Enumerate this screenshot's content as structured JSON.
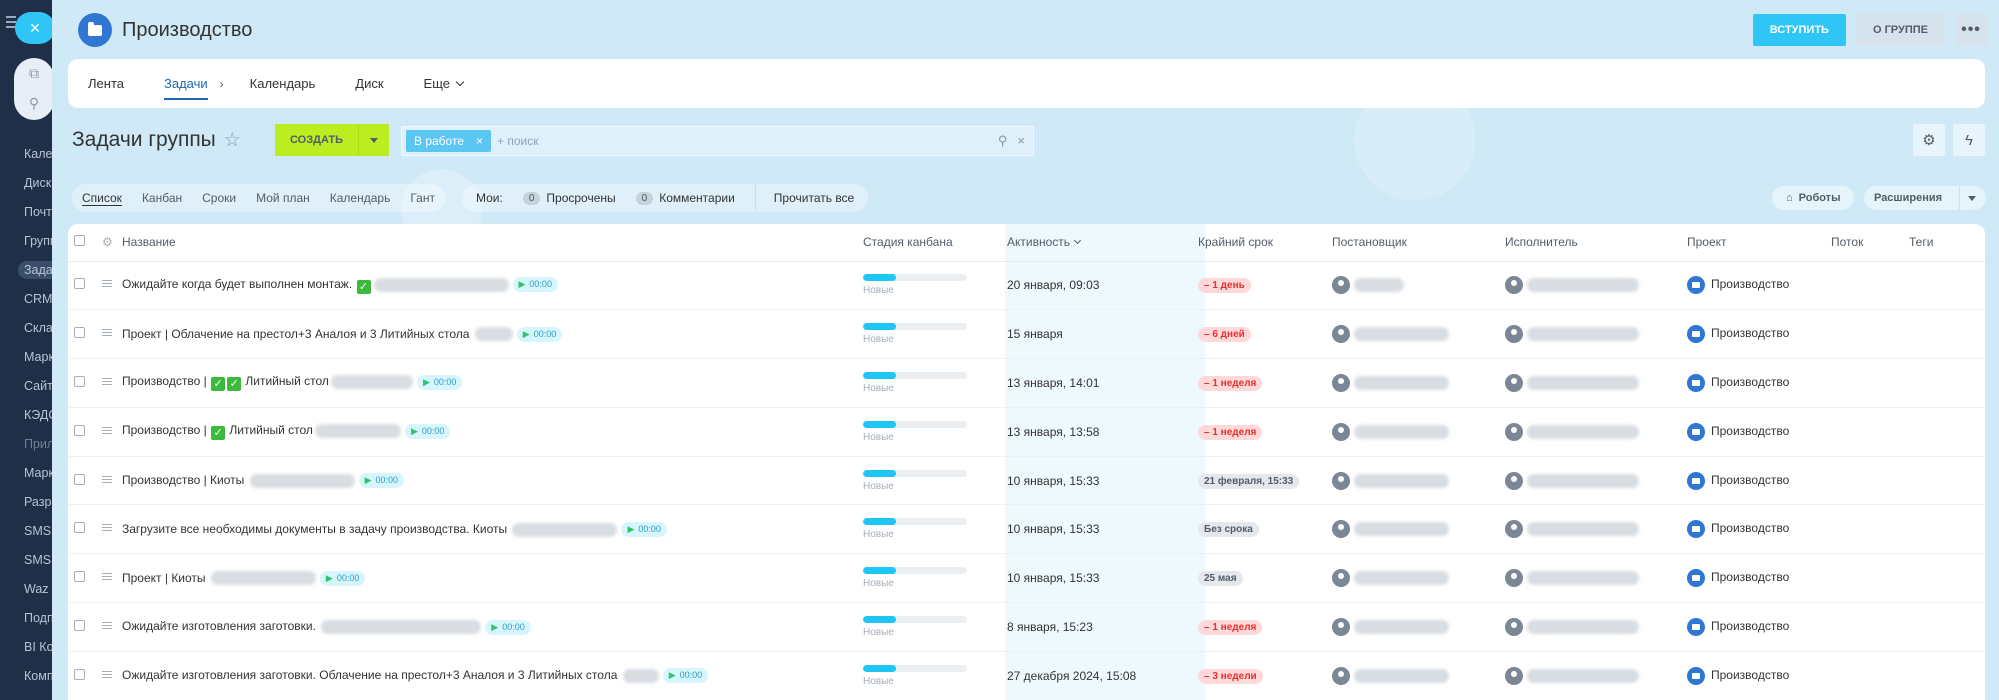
{
  "sidebar": {
    "items": [
      {
        "label": "Кален"
      },
      {
        "label": "Диск"
      },
      {
        "label": "Почт"
      },
      {
        "label": "Групп"
      },
      {
        "label": "Задач"
      },
      {
        "label": "CRM"
      },
      {
        "label": "Склад"
      },
      {
        "label": "Марк"
      },
      {
        "label": "Сайт"
      },
      {
        "label": "КЭДО"
      },
      {
        "label": "Прил"
      },
      {
        "label": "Марк"
      },
      {
        "label": "Разр"
      },
      {
        "label": "SMS"
      },
      {
        "label": "SMS"
      },
      {
        "label": "Waz"
      },
      {
        "label": "Подп"
      },
      {
        "label": "BI Ко"
      },
      {
        "label": "Комп"
      }
    ]
  },
  "header": {
    "group_title": "Производство",
    "join_label": "ВСТУПИТЬ",
    "about_label": "О ГРУППЕ"
  },
  "tabs": {
    "feed": "Лента",
    "tasks": "Задачи",
    "calendar": "Календарь",
    "disk": "Диск",
    "more": "Еще"
  },
  "toolbar": {
    "title": "Задачи группы",
    "create_label": "СОЗДАТЬ",
    "filter_chip": "В работе",
    "search_placeholder": "+ поиск"
  },
  "views": {
    "list": "Список",
    "kanban": "Канбан",
    "deadlines": "Сроки",
    "my_plan": "Мой план",
    "calendar": "Календарь",
    "gantt": "Гант"
  },
  "my": {
    "label": "Мои:",
    "overdue_count": "0",
    "overdue_label": "Просрочены",
    "comments_count": "0",
    "comments_label": "Комментарии",
    "read_all": "Прочитать все"
  },
  "robots_label": "Роботы",
  "extensions_label": "Расширения",
  "table": {
    "headers": {
      "name": "Название",
      "stage": "Стадия канбана",
      "activity": "Активность",
      "deadline": "Крайний срок",
      "creator": "Постановщик",
      "responsible": "Исполнитель",
      "project": "Проект",
      "flow": "Поток",
      "tags": "Теги"
    },
    "rows": [
      {
        "name": "Ожидайте когда будет выполнен монтаж.",
        "checks": 1,
        "timer": "00:00",
        "stage": "Новые",
        "activity": "20 января, 09:03",
        "deadline": "– 1 день",
        "overdue": true,
        "project": "Производство"
      },
      {
        "name": "Проект | Облачение на престол+3 Аналоя и 3 Литийных стола",
        "checks": 0,
        "timer": "00:00",
        "stage": "Новые",
        "activity": "15 января",
        "deadline": "– 6 дней",
        "overdue": true,
        "project": "Производство"
      },
      {
        "name_prefix": "Производство |",
        "checks": 2,
        "name": "Литийный стол",
        "timer": "00:00",
        "stage": "Новые",
        "activity": "13 января, 14:01",
        "deadline": "– 1 неделя",
        "overdue": true,
        "project": "Производство"
      },
      {
        "name_prefix": "Производство |",
        "checks": 1,
        "name": "Литийный стол",
        "timer": "00:00",
        "stage": "Новые",
        "activity": "13 января, 13:58",
        "deadline": "– 1 неделя",
        "overdue": true,
        "project": "Производство"
      },
      {
        "name": "Производство | Киоты",
        "checks": 0,
        "timer": "00:00",
        "stage": "Новые",
        "activity": "10 января, 15:33",
        "deadline": "21 февраля, 15:33",
        "overdue": false,
        "project": "Производство"
      },
      {
        "name": "Загрузите все необходимы документы в задачу производства. Киоты",
        "checks": 0,
        "timer": "00:00",
        "stage": "Новые",
        "activity": "10 января, 15:33",
        "deadline": "Без срока",
        "overdue": false,
        "project": "Производство"
      },
      {
        "name": "Проект | Киоты",
        "checks": 0,
        "timer": "00:00",
        "stage": "Новые",
        "activity": "10 января, 15:33",
        "deadline": "25 мая",
        "overdue": false,
        "project": "Производство"
      },
      {
        "name": "Ожидайте изготовления заготовки.",
        "checks": 0,
        "timer": "00:00",
        "stage": "Новые",
        "activity": "8 января, 15:23",
        "deadline": "– 1 неделя",
        "overdue": true,
        "project": "Производство"
      },
      {
        "name": "Ожидайте изготовления заготовки. Облачение на престол+3 Аналоя и 3 Литийных стола",
        "checks": 0,
        "timer": "00:00",
        "stage": "Новые",
        "activity": "27 декабря 2024, 15:08",
        "deadline": "– 3 недели",
        "overdue": true,
        "project": "Производство"
      }
    ]
  },
  "colors": {
    "accent": "#2fc6f6",
    "create": "#bbed21",
    "overdue": "#e53030",
    "sidebar": "#1f2f48"
  }
}
